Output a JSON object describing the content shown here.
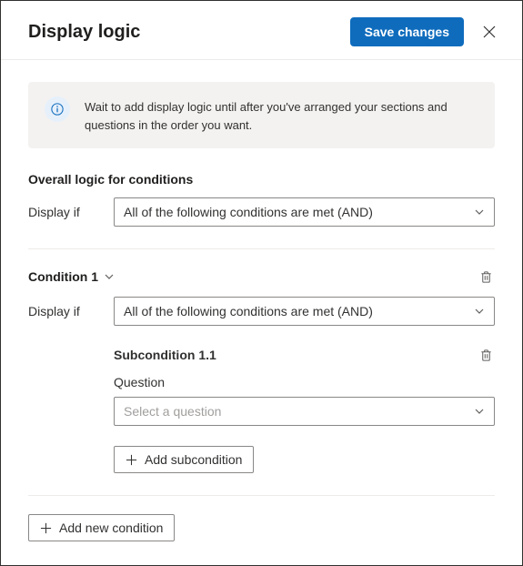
{
  "header": {
    "title": "Display logic",
    "save_label": "Save changes"
  },
  "info": {
    "text": "Wait to add display logic until after you've arranged your sections and questions in the order you want."
  },
  "overall": {
    "heading": "Overall logic for conditions",
    "display_if_label": "Display if",
    "select_value": "All of the following conditions are met (AND)"
  },
  "condition": {
    "title": "Condition 1",
    "display_if_label": "Display if",
    "select_value": "All of the following conditions are met (AND)"
  },
  "subcondition": {
    "title": "Subcondition 1.1",
    "question_label": "Question",
    "question_placeholder": "Select a question",
    "add_label": "Add subcondition"
  },
  "footer": {
    "add_condition_label": "Add new condition"
  }
}
